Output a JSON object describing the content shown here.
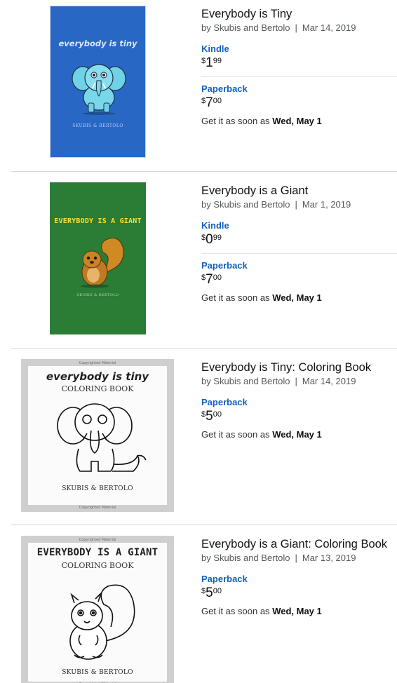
{
  "results": [
    {
      "title": "Everybody is Tiny",
      "authors": "by Skubis and Bertolo",
      "separator": "|",
      "date": "Mar 14, 2019",
      "cover": {
        "title": "everybody is tiny",
        "author": "Skubis & Bertolo",
        "bg": "#2868c4",
        "art": "elephant-icon"
      },
      "options": [
        {
          "format": "Kindle",
          "currency": "$",
          "whole": "1",
          "fraction": "99"
        },
        {
          "format": "Paperback",
          "currency": "$",
          "whole": "7",
          "fraction": "00"
        }
      ],
      "delivery_prefix": "Get it as soon as",
      "delivery_date": "Wed, May 1"
    },
    {
      "title": "Everybody is a Giant",
      "authors": "by Skubis and Bertolo",
      "separator": "|",
      "date": "Mar 1, 2019",
      "cover": {
        "title": "EVERYBODY IS A GIANT",
        "author": "Skubis & Bertolo",
        "bg": "#2b7c35",
        "art": "squirrel-icon"
      },
      "options": [
        {
          "format": "Kindle",
          "currency": "$",
          "whole": "0",
          "fraction": "99"
        },
        {
          "format": "Paperback",
          "currency": "$",
          "whole": "7",
          "fraction": "00"
        }
      ],
      "delivery_prefix": "Get it as soon as",
      "delivery_date": "Wed, May 1"
    },
    {
      "title": "Everybody is Tiny: Coloring Book",
      "authors": "by Skubis and Bertolo",
      "separator": "|",
      "date": "Mar 14, 2019",
      "cover": {
        "note": "Copyrighted Material",
        "title": "everybody is tiny",
        "subtitle": "COLORING BOOK",
        "author": "Skubis & Bertolo",
        "art": "elephant-outline-icon"
      },
      "options": [
        {
          "format": "Paperback",
          "currency": "$",
          "whole": "5",
          "fraction": "00"
        }
      ],
      "delivery_prefix": "Get it as soon as",
      "delivery_date": "Wed, May 1"
    },
    {
      "title": "Everybody is a Giant: Coloring Book",
      "authors": "by Skubis and Bertolo",
      "separator": "|",
      "date": "Mar 13, 2019",
      "cover": {
        "note": "Copyrighted Material",
        "title": "EVERYBODY IS A GIANT",
        "subtitle": "COLORING BOOK",
        "author": "Skubis & Bertolo",
        "art": "squirrel-outline-icon"
      },
      "options": [
        {
          "format": "Paperback",
          "currency": "$",
          "whole": "5",
          "fraction": "00"
        }
      ],
      "delivery_prefix": "Get it as soon as",
      "delivery_date": "Wed, May 1"
    }
  ]
}
